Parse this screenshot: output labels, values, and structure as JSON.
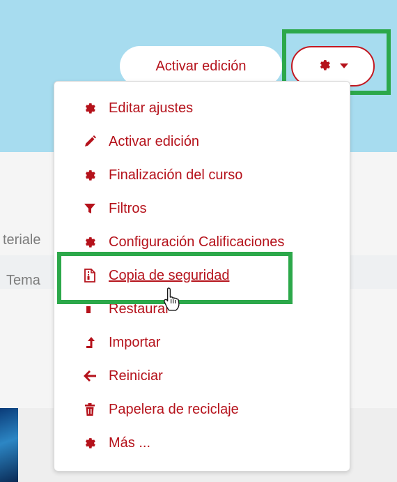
{
  "header": {
    "edit_button_label": "Activar edición",
    "settings_icon": "gear-icon",
    "caret_icon": "caret-down-icon"
  },
  "background": {
    "left_text_1": "teriale",
    "left_text_2": "Tema"
  },
  "menu": {
    "items": [
      {
        "label": "Editar ajustes",
        "icon": "gear-icon"
      },
      {
        "label": "Activar edición",
        "icon": "pencil-icon"
      },
      {
        "label": "Finalización del curso",
        "icon": "gear-icon"
      },
      {
        "label": "Filtros",
        "icon": "filter-icon"
      },
      {
        "label": "Configuración Calificaciones",
        "icon": "gear-icon"
      },
      {
        "label": "Copia de seguridad",
        "icon": "file-archive-icon"
      },
      {
        "label": "Restaurar",
        "icon": "upload-icon"
      },
      {
        "label": "Importar",
        "icon": "level-up-icon"
      },
      {
        "label": "Reiniciar",
        "icon": "arrow-left-icon"
      },
      {
        "label": "Papelera de reciclaje",
        "icon": "trash-icon"
      },
      {
        "label": "Más ...",
        "icon": "gear-icon"
      }
    ]
  },
  "colors": {
    "accent": "#b5121b",
    "header_bg": "#a7dcef",
    "highlight": "#2ca84a"
  }
}
